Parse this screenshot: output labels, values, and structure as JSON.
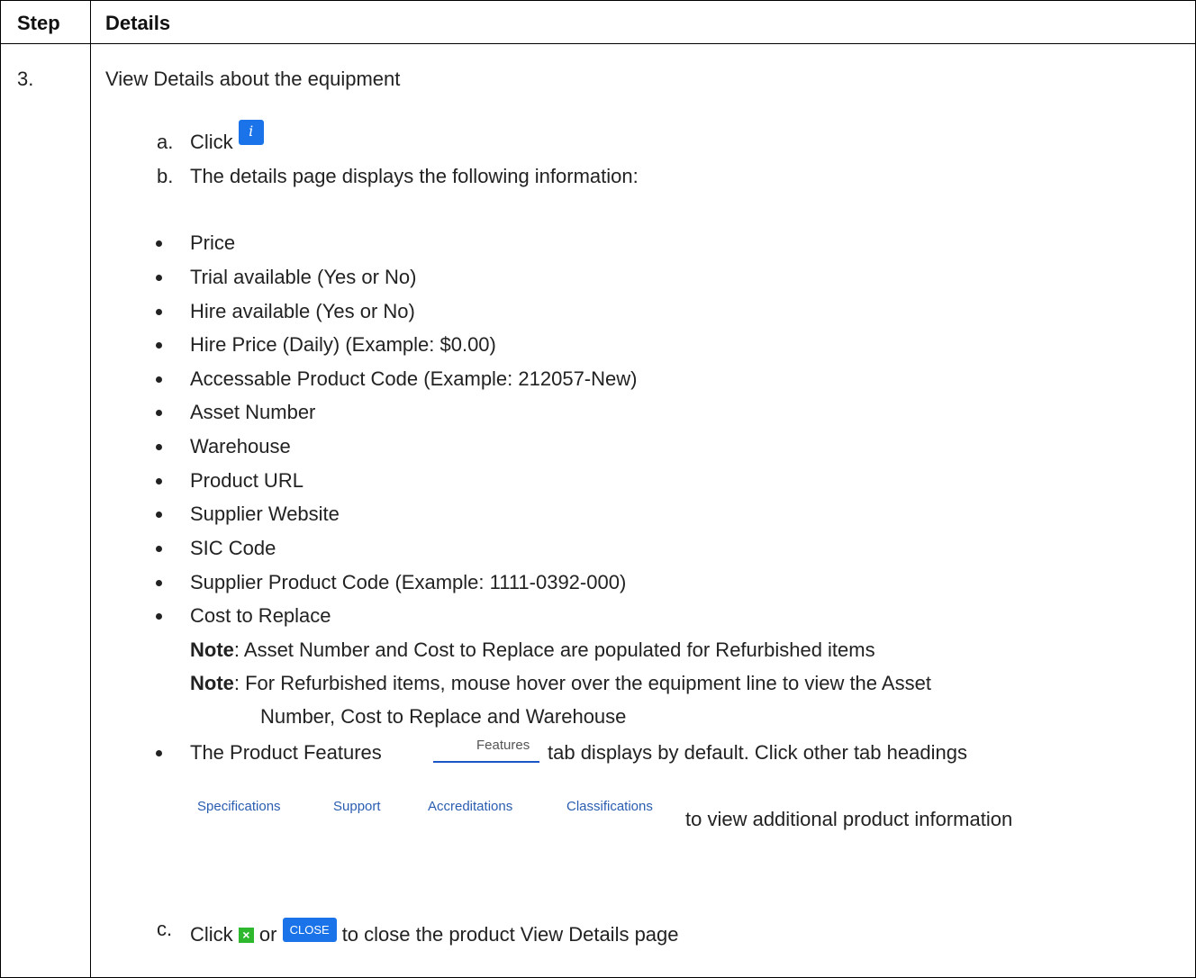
{
  "header": {
    "step": "Step",
    "details": "Details"
  },
  "step": {
    "number": "3.",
    "intro": "View Details about the equipment",
    "a": {
      "marker": "a.",
      "text": "Click",
      "icon": "info-icon"
    },
    "b": {
      "marker": "b.",
      "text": "The details page displays the following information:"
    },
    "bullets": [
      "Price",
      "Trial available (Yes or No)",
      "Hire available (Yes or No)",
      "Hire Price (Daily) (Example: $0.00)",
      "Accessable Product Code (Example: 212057-New)",
      "Asset Number",
      "Warehouse",
      "Product URL",
      "Supplier Website",
      "SIC Code",
      "Supplier Product Code (Example: 1111-0392-000)",
      "Cost to Replace"
    ],
    "notes": [
      {
        "label": "Note",
        "text": ": Asset Number and Cost to Replace are populated for Refurbished items"
      },
      {
        "label": "Note",
        "text": ": For Refurbished items, mouse hover over the equipment line to view the Asset"
      }
    ],
    "note_continuation": "Number, Cost to Replace and Warehouse",
    "features": {
      "lead": "The Product Features",
      "tab_label": "Features",
      "trail": "tab displays by default. Click other tab headings",
      "tabs": [
        "Specifications",
        "Support",
        "Accreditations",
        "Classifications"
      ],
      "after_tabs": "to view additional product information"
    },
    "c": {
      "marker": "c.",
      "click": "Click",
      "or": "or",
      "close_label": "CLOSE",
      "close_icon": "close-x-icon",
      "tail": "to close the product View Details page"
    }
  },
  "colors": {
    "accent": "#1a73e8",
    "close_green": "#2eb82e",
    "tab_link": "#2a5db0"
  }
}
